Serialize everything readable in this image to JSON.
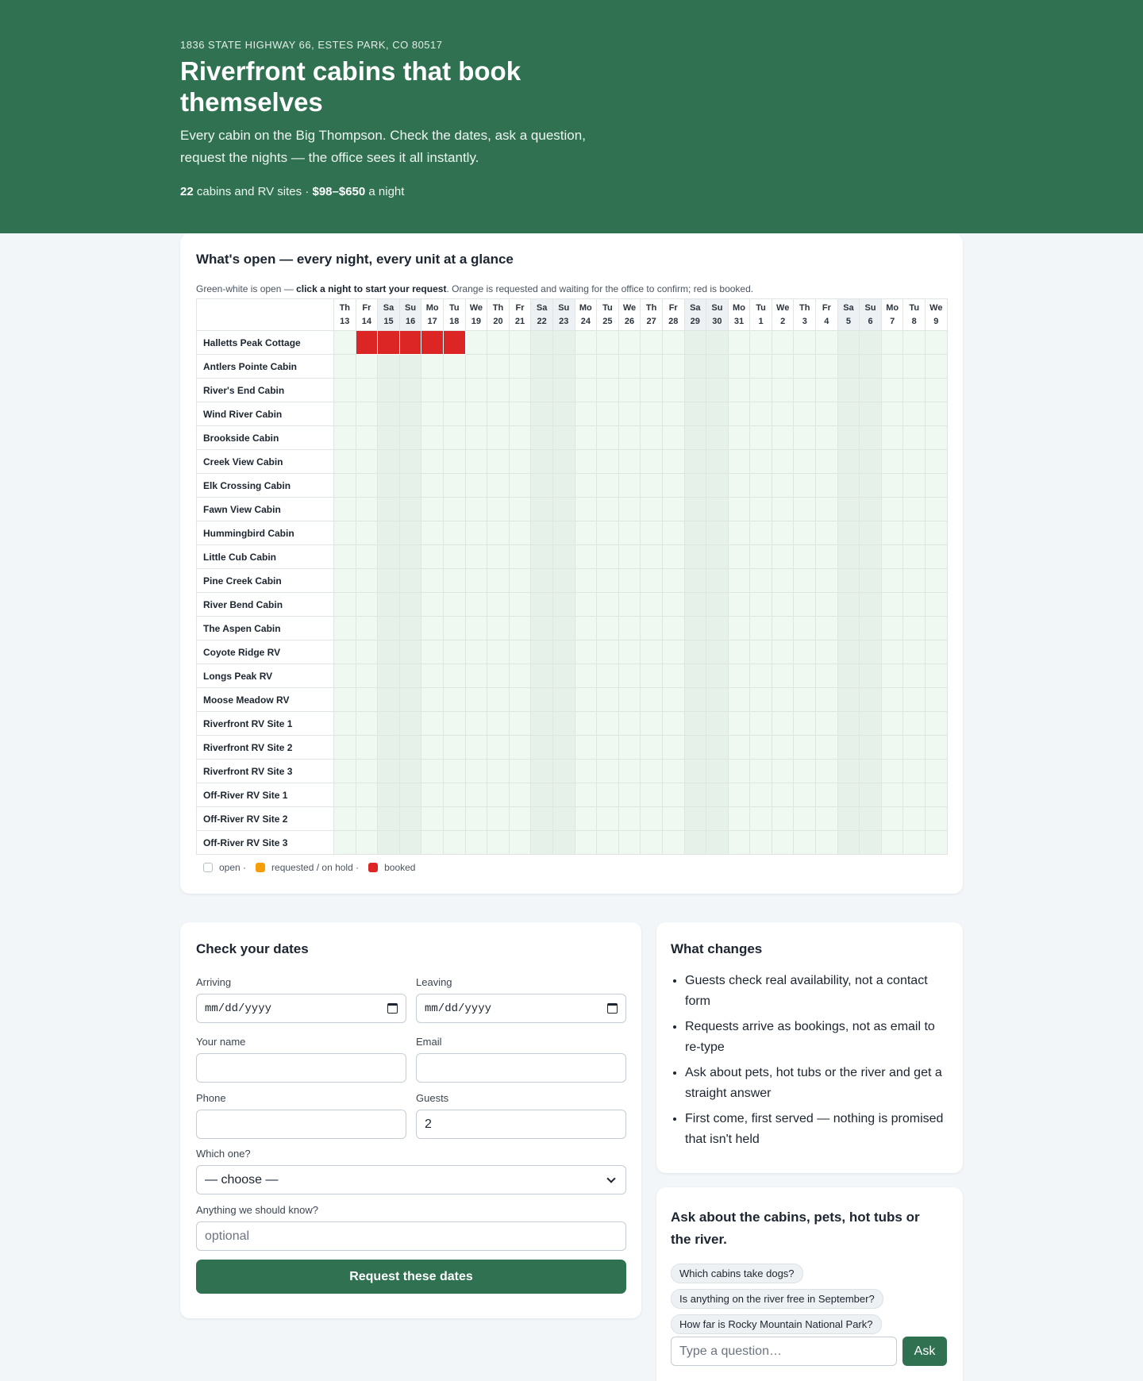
{
  "hero": {
    "address": "1836 STATE HIGHWAY 66, ESTES PARK, CO 80517",
    "title": "Riverfront cabins that book themselves",
    "lede": "Every cabin on the Big Thompson. Check the dates, ask a question, request the nights — the office sees it all instantly.",
    "unit_count": "22",
    "unit_label": " cabins and RV sites · ",
    "price_range": "$98–$650",
    "price_suffix": " a night"
  },
  "availability": {
    "title": "What's open — every night, every unit at a glance",
    "hint_pre": "Green-white is open — ",
    "hint_bold": "click a night to start your request",
    "hint_post": ". Orange is requested and waiting for the office to confirm; red is booked.",
    "days": [
      {
        "dow": "Th",
        "date": "13"
      },
      {
        "dow": "Fr",
        "date": "14"
      },
      {
        "dow": "Sa",
        "date": "15"
      },
      {
        "dow": "Su",
        "date": "16"
      },
      {
        "dow": "Mo",
        "date": "17"
      },
      {
        "dow": "Tu",
        "date": "18"
      },
      {
        "dow": "We",
        "date": "19"
      },
      {
        "dow": "Th",
        "date": "20"
      },
      {
        "dow": "Fr",
        "date": "21"
      },
      {
        "dow": "Sa",
        "date": "22"
      },
      {
        "dow": "Su",
        "date": "23"
      },
      {
        "dow": "Mo",
        "date": "24"
      },
      {
        "dow": "Tu",
        "date": "25"
      },
      {
        "dow": "We",
        "date": "26"
      },
      {
        "dow": "Th",
        "date": "27"
      },
      {
        "dow": "Fr",
        "date": "28"
      },
      {
        "dow": "Sa",
        "date": "29"
      },
      {
        "dow": "Su",
        "date": "30"
      },
      {
        "dow": "Mo",
        "date": "31"
      },
      {
        "dow": "Tu",
        "date": "1"
      },
      {
        "dow": "We",
        "date": "2"
      },
      {
        "dow": "Th",
        "date": "3"
      },
      {
        "dow": "Fr",
        "date": "4"
      },
      {
        "dow": "Sa",
        "date": "5"
      },
      {
        "dow": "Su",
        "date": "6"
      },
      {
        "dow": "Mo",
        "date": "7"
      },
      {
        "dow": "Tu",
        "date": "8"
      },
      {
        "dow": "We",
        "date": "9"
      }
    ],
    "units": [
      {
        "name": "Halletts Peak Cottage",
        "booked": [
          1,
          2,
          3,
          4,
          5
        ],
        "held": []
      },
      {
        "name": "Antlers Pointe Cabin",
        "booked": [],
        "held": []
      },
      {
        "name": "River's End Cabin",
        "booked": [],
        "held": []
      },
      {
        "name": "Wind River Cabin",
        "booked": [],
        "held": []
      },
      {
        "name": "Brookside Cabin",
        "booked": [],
        "held": []
      },
      {
        "name": "Creek View Cabin",
        "booked": [],
        "held": []
      },
      {
        "name": "Elk Crossing Cabin",
        "booked": [],
        "held": []
      },
      {
        "name": "Fawn View Cabin",
        "booked": [],
        "held": []
      },
      {
        "name": "Hummingbird Cabin",
        "booked": [],
        "held": []
      },
      {
        "name": "Little Cub Cabin",
        "booked": [],
        "held": []
      },
      {
        "name": "Pine Creek Cabin",
        "booked": [],
        "held": []
      },
      {
        "name": "River Bend Cabin",
        "booked": [],
        "held": []
      },
      {
        "name": "The Aspen Cabin",
        "booked": [],
        "held": []
      },
      {
        "name": "Coyote Ridge RV",
        "booked": [],
        "held": []
      },
      {
        "name": "Longs Peak RV",
        "booked": [],
        "held": []
      },
      {
        "name": "Moose Meadow RV",
        "booked": [],
        "held": []
      },
      {
        "name": "Riverfront RV Site 1",
        "booked": [],
        "held": []
      },
      {
        "name": "Riverfront RV Site 2",
        "booked": [],
        "held": []
      },
      {
        "name": "Riverfront RV Site 3",
        "booked": [],
        "held": []
      },
      {
        "name": "Off-River RV Site 1",
        "booked": [],
        "held": []
      },
      {
        "name": "Off-River RV Site 2",
        "booked": [],
        "held": []
      },
      {
        "name": "Off-River RV Site 3",
        "booked": [],
        "held": []
      }
    ],
    "legend": {
      "open": "open ·",
      "held": "requested / on hold ·",
      "booked": "booked"
    },
    "colors": {
      "open": "#f0f8f2",
      "held": "#f59e0b",
      "booked": "#dc2626"
    }
  },
  "form": {
    "title": "Check your dates",
    "arriving_label": "Arriving",
    "arriving_value": "mm/dd/yyyy",
    "leaving_label": "Leaving",
    "leaving_value": "mm/dd/yyyy",
    "name_label": "Your name",
    "name_value": "",
    "email_label": "Email",
    "email_value": "",
    "phone_label": "Phone",
    "phone_value": "",
    "guests_label": "Guests",
    "guests_value": "2",
    "which_label": "Which one?",
    "which_value": "— choose —",
    "notes_label": "Anything we should know?",
    "notes_placeholder": "optional",
    "submit_label": "Request these dates"
  },
  "changes": {
    "title": "What changes",
    "items": [
      "Guests check real availability, not a contact form",
      "Requests arrive as bookings, not as email to re-type",
      "Ask about pets, hot tubs or the river and get a straight answer",
      "First come, first served — nothing is promised that isn't held"
    ]
  },
  "ask": {
    "title": "Ask about the cabins, pets, hot tubs or the river.",
    "suggestions": [
      "Which cabins take dogs?",
      "Is anything on the river free in September?",
      "How far is Rocky Mountain National Park?"
    ],
    "input_placeholder": "Type a question…",
    "button_label": "Ask"
  },
  "colors": {
    "brand": "#2f7150",
    "background": "#f3f6f9"
  }
}
